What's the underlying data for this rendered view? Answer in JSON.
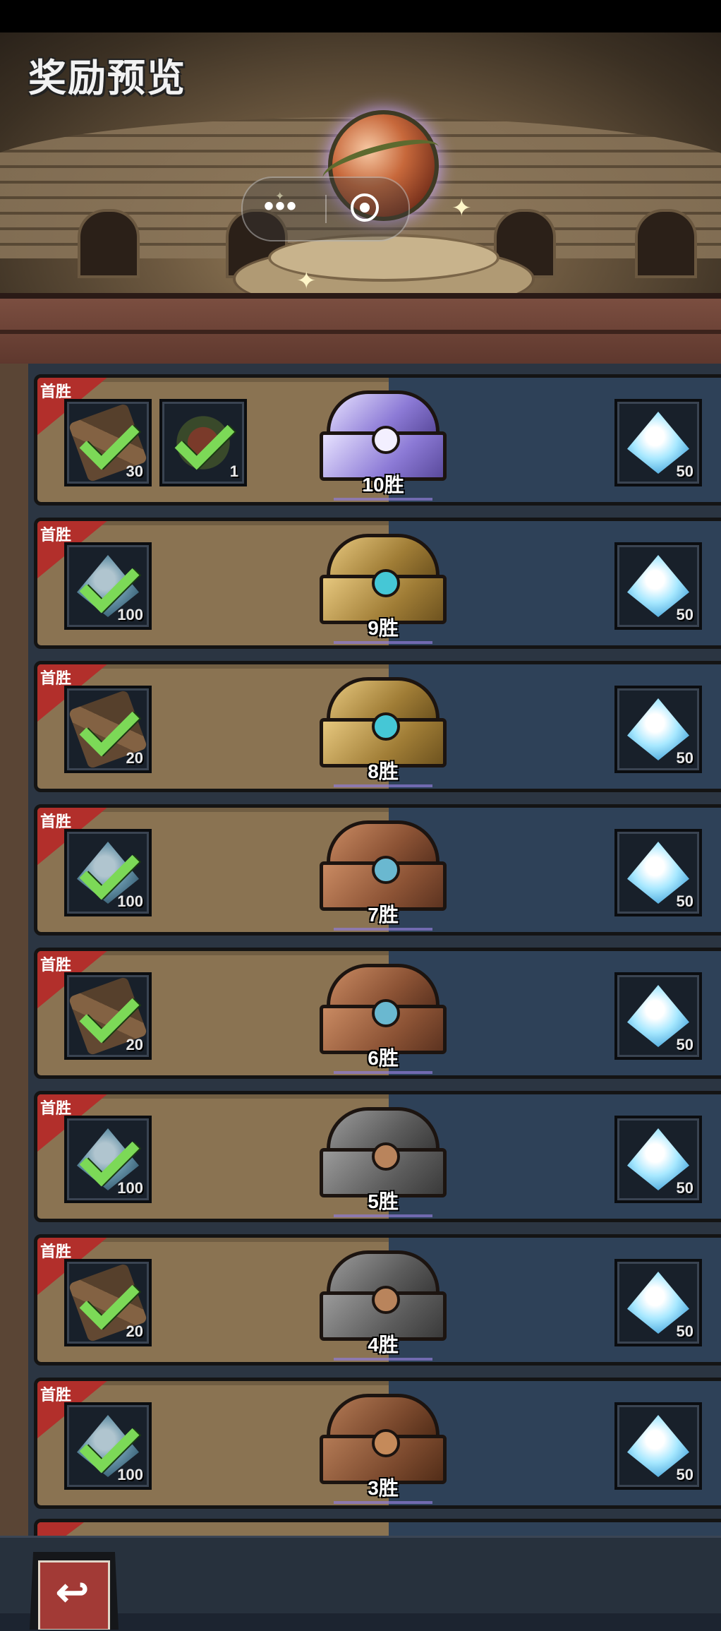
{
  "header": {
    "title": "奖励预览",
    "capsule_more": "•••"
  },
  "first_win_label": "首胜",
  "rows": [
    {
      "wins": "10胜",
      "chest": "crystal",
      "first_win_items": [
        {
          "icon": "wood-plank-icon",
          "count": "30",
          "claimed": true
        },
        {
          "icon": "thorn-orb-icon",
          "count": "1",
          "claimed": true
        }
      ],
      "reward": {
        "icon": "crystal-gem-icon",
        "count": "50"
      }
    },
    {
      "wins": "9胜",
      "chest": "gold",
      "first_win_items": [
        {
          "icon": "gem-icon",
          "count": "100",
          "claimed": true
        }
      ],
      "reward": {
        "icon": "crystal-gem-icon",
        "count": "50"
      }
    },
    {
      "wins": "8胜",
      "chest": "gold",
      "first_win_items": [
        {
          "icon": "wood-plank-icon",
          "count": "20",
          "claimed": true
        }
      ],
      "reward": {
        "icon": "crystal-gem-icon",
        "count": "50"
      }
    },
    {
      "wins": "7胜",
      "chest": "bronze",
      "first_win_items": [
        {
          "icon": "gem-icon",
          "count": "100",
          "claimed": true
        }
      ],
      "reward": {
        "icon": "crystal-gem-icon",
        "count": "50"
      }
    },
    {
      "wins": "6胜",
      "chest": "bronze",
      "first_win_items": [
        {
          "icon": "wood-plank-icon",
          "count": "20",
          "claimed": true
        }
      ],
      "reward": {
        "icon": "crystal-gem-icon",
        "count": "50"
      }
    },
    {
      "wins": "5胜",
      "chest": "iron",
      "first_win_items": [
        {
          "icon": "gem-icon",
          "count": "100",
          "claimed": true
        }
      ],
      "reward": {
        "icon": "crystal-gem-icon",
        "count": "50"
      }
    },
    {
      "wins": "4胜",
      "chest": "iron",
      "first_win_items": [
        {
          "icon": "wood-plank-icon",
          "count": "20",
          "claimed": true
        }
      ],
      "reward": {
        "icon": "crystal-gem-icon",
        "count": "50"
      }
    },
    {
      "wins": "3胜",
      "chest": "wood",
      "first_win_items": [
        {
          "icon": "gem-icon",
          "count": "100",
          "claimed": true
        }
      ],
      "reward": {
        "icon": "crystal-gem-icon",
        "count": "50"
      }
    }
  ],
  "bottom": {
    "back_icon": "↩"
  },
  "colors": {
    "first_win_badge": "#b22f2b",
    "check": "#7cd957",
    "row_left": "#8a7352",
    "row_right": "#2e4158"
  }
}
